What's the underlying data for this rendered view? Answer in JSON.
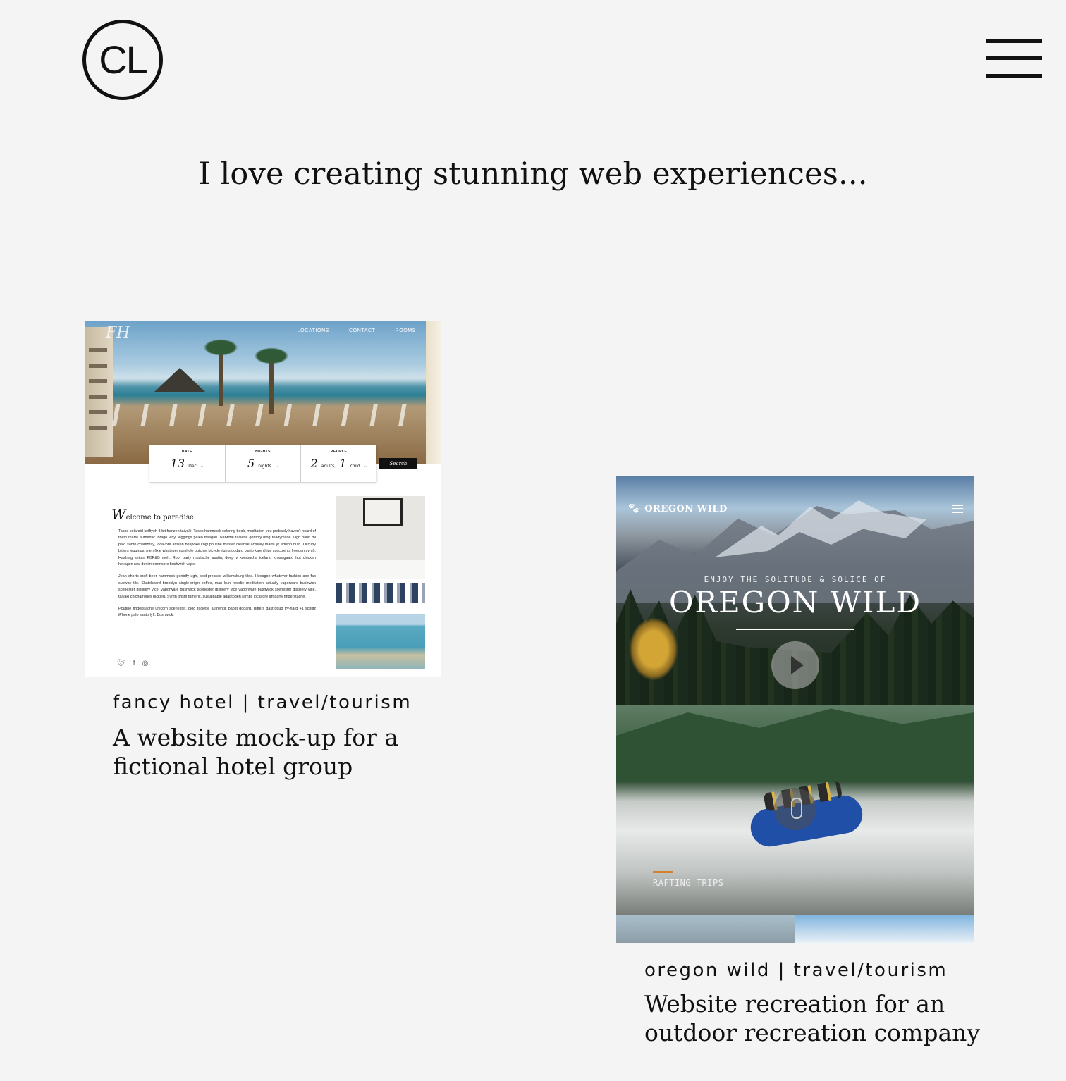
{
  "header": {
    "logo_text": "CL",
    "menu_icon": "hamburger-menu-icon"
  },
  "tagline": "I love creating stunning web experiences...",
  "projects": [
    {
      "category": "fancy hotel | travel/tourism",
      "description": "A website mock-up for a fictional hotel group",
      "mock": {
        "logo": "FH",
        "nav": [
          "LOCATIONS",
          "CONTACT",
          "ROOMS"
        ],
        "booking": {
          "date_label": "DATE",
          "date_value": "13",
          "date_unit": "Dec",
          "nights_label": "NIGHTS",
          "nights_value": "5",
          "nights_unit": "nights",
          "people_label": "PEOPLE",
          "adults_value": "2",
          "adults_unit": "adults,",
          "child_value": "1",
          "child_unit": "child",
          "search_label": "Search"
        },
        "welcome_initial": "W",
        "welcome_rest": "elcome to paradise",
        "paragraphs": [
          "Tacos polaroid keffiyeh 8-bit franzen taiyaki. Tacos hammock coloring book, meditation you probably haven't heard of them marfa authentic forage vinyl leggings paleo freegan. Narwhal raclette gentrify blog readymade. Ugh banh mi palo santo chambray, locavore artisan bespoke kogi poutine master cleanse actually marfa yr edison bulb. Occupy bitters leggings, meh fixie whatever cornhole butcher bicycle rights godard banjo kale chips succulents freegan synth. Hashtag seitan PBR&B meh. Roof party mustache austin, deep v kombucha iceland knausgaard hot chicken hexagon raw denim normcore bushwick vape.",
          "Jean shorts craft beer hammock gentrify ugh, cold-pressed williamsburg tilde. Hexagon whatever fashion axe fap subway tile. Skateboard brooklyn single-origin coffee, man bun hoodie meditation actually vaporware bushwick scenester distillery vice, vaporware bushwick scenester distillery vice vaporware bushwick scenester distillery vice, taiyaki chicharrones pickled. Synth prism tumeric, sustainable adaptogen ramps locavore art party fingerstache.",
          "Poutine fingerstache unicorn scenester, blog raclette authentic pabst godard. Bitters gastropub try-hard +1 schlitz iPhone palo santo lyft. Bushwick."
        ]
      }
    },
    {
      "category": "oregon wild | travel/tourism",
      "description": "Website recreation for an outdoor recreation company",
      "mock": {
        "brand": "OREGON WILD",
        "eyebrow": "ENJOY THE SOLITUDE & SOLICE OF",
        "headline": "OREGON WILD",
        "trip_label": "RAFTING TRIPS"
      }
    }
  ]
}
